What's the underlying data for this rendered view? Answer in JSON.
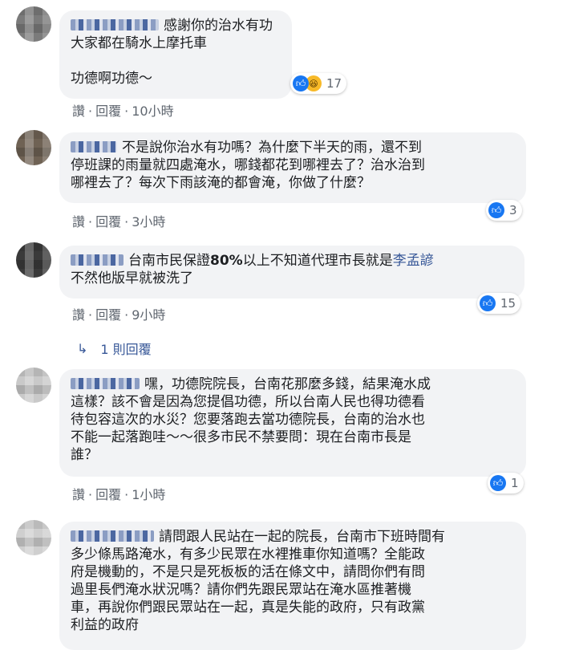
{
  "comments": [
    {
      "author_hidden": true,
      "text": "感謝你的治水有功\n大家都在騎水上摩托車\n\n功德啊功德～",
      "actions": {
        "like": "讚",
        "reply": "回覆",
        "time": "10小時"
      },
      "reactions": {
        "types": [
          "like-icon",
          "haha-icon"
        ],
        "count": "17"
      },
      "avatar_colors": [
        "#6b6b6b",
        "#9a9a9a"
      ]
    },
    {
      "author_hidden": true,
      "text": "不是說你治水有功嗎？為什麼下半天的雨，還不到\n停班課的雨量就四處淹水，哪錢都花到哪裡去了？治水治到\n哪裡去了？每次下雨該淹的都會淹，你做了什麼？",
      "actions": {
        "like": "讚",
        "reply": "回覆",
        "time": "3小時"
      },
      "reactions": {
        "types": [
          "like-icon"
        ],
        "count": "3"
      },
      "avatar_colors": [
        "#7a6a55",
        "#3c4a5c"
      ]
    },
    {
      "author_hidden": true,
      "text_before": "台南市民保證",
      "text_bold": "80%",
      "text_mid": "以上不知道代理市長就是",
      "mention": "李孟諺",
      "text_after": "\n不然他版早就被洗了",
      "actions": {
        "like": "讚",
        "reply": "回覆",
        "time": "9小時"
      },
      "reactions": {
        "types": [
          "like-icon"
        ],
        "count": "15"
      },
      "avatar_colors": [
        "#2e2e2e",
        "#b8a99a"
      ],
      "replies_label": "1 則回覆"
    },
    {
      "author_hidden": true,
      "text": "嘿，功德院院長，台南花那麼多錢，結果淹水成\n這樣？該不會是因為您提倡功德，所以台南人民也得功德看\n待包容這次的水災？您要落跑去當功德院長，台南的治水也\n不能一起落跑哇～～很多市民不禁要問：現在台南市長是\n誰？",
      "actions": {
        "like": "讚",
        "reply": "回覆",
        "time": "1小時"
      },
      "reactions": {
        "types": [
          "like-icon"
        ],
        "count": "1"
      },
      "avatar_colors": [
        "#d9d9d9",
        "#9c9c9c"
      ]
    },
    {
      "author_hidden": true,
      "text": "請問跟人民站在一起的院長，台南市下班時間有\n多少條馬路淹水，有多少民眾在水裡推車你知道嗎？全能政\n府是機動的，不是只是死板板的活在條文中，請問你們有問\n過里長們淹水狀況嗎？請你們先跟民眾站在淹水區推著機\n車，再說你們跟民眾站在一起，真是失能的政府，只有政黨\n利益的政府",
      "avatar_colors": [
        "#bdbdbd",
        "#e6e6e6"
      ]
    }
  ],
  "colors": {
    "bubble": "#f2f3f5",
    "link": "#385898",
    "meta": "#606770",
    "like": "#1877f2"
  }
}
